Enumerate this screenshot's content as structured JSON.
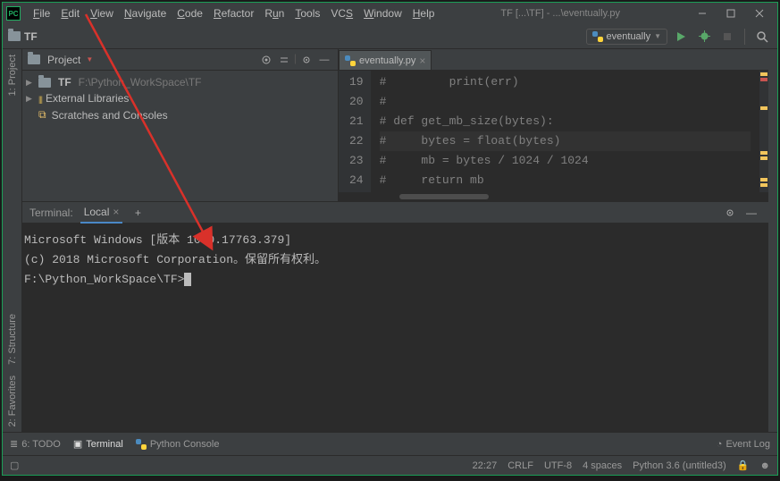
{
  "window": {
    "app_abbr": "PC",
    "title": "TF [...\\TF] - ...\\eventually.py"
  },
  "menu": [
    "File",
    "Edit",
    "View",
    "Navigate",
    "Code",
    "Refactor",
    "Run",
    "Tools",
    "VCS",
    "Window",
    "Help"
  ],
  "toolbar": {
    "breadcrumb": "TF",
    "run_config": "eventually"
  },
  "left_tabs": {
    "project": "1: Project",
    "structure": "7: Structure",
    "favorites": "2: Favorites"
  },
  "project_panel": {
    "title": "Project",
    "root_name": "TF",
    "root_path": "F:\\Python_WorkSpace\\TF",
    "external_libs": "External Libraries",
    "scratches": "Scratches and Consoles"
  },
  "editor": {
    "tab_name": "eventually.py",
    "lines": [
      {
        "n": 19,
        "t": "#         print(err)"
      },
      {
        "n": 20,
        "t": "#"
      },
      {
        "n": 21,
        "t": "# def get_mb_size(bytes):"
      },
      {
        "n": 22,
        "t": "#     bytes = float(bytes)"
      },
      {
        "n": 23,
        "t": "#     mb = bytes / 1024 / 1024"
      },
      {
        "n": 24,
        "t": "#     return mb"
      }
    ]
  },
  "terminal": {
    "header_label": "Terminal:",
    "tab_name": "Local",
    "lines": [
      "Microsoft Windows [版本 10.0.17763.379]",
      "(c) 2018 Microsoft Corporation。保留所有权利。",
      "",
      "F:\\Python_WorkSpace\\TF>"
    ]
  },
  "bottom_tools": {
    "todo": "6: TODO",
    "terminal": "Terminal",
    "pyconsole": "Python Console",
    "eventlog": "Event Log"
  },
  "status": {
    "time": "22:27",
    "line_sep": "CRLF",
    "encoding": "UTF-8",
    "indent": "4 spaces",
    "interpreter": "Python 3.6 (untitled3)"
  }
}
